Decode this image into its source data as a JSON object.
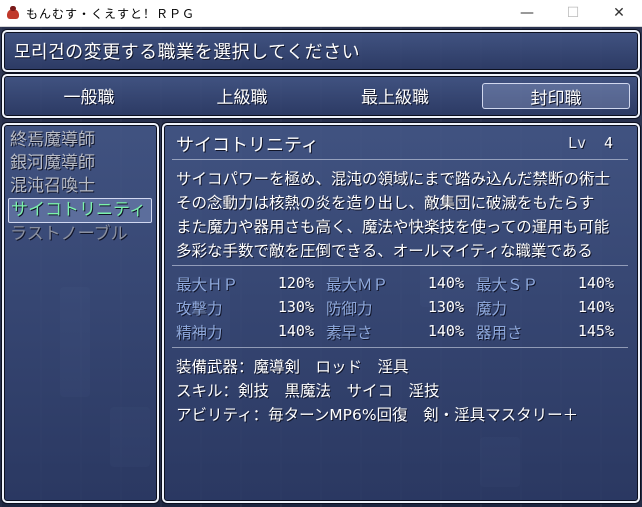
{
  "window": {
    "title": "もんむす・くえすと！ＲＰＧ",
    "controls": {
      "minimize": "—",
      "maximize": "☐",
      "close": "✕"
    }
  },
  "help": {
    "text": "모리건の変更する職業を選択してください"
  },
  "tabs": [
    {
      "label": "一般職",
      "selected": false
    },
    {
      "label": "上級職",
      "selected": false
    },
    {
      "label": "最上級職",
      "selected": false
    },
    {
      "label": "封印職",
      "selected": true
    }
  ],
  "job_list": [
    {
      "label": "終焉魔導師",
      "state": "dim"
    },
    {
      "label": "銀河魔導師",
      "state": "dim"
    },
    {
      "label": "混沌召喚士",
      "state": "dim"
    },
    {
      "label": "サイコトリニティ",
      "state": "selected"
    },
    {
      "label": "ラストノーブル",
      "state": "faded"
    }
  ],
  "detail": {
    "name": "サイコトリニティ",
    "lv_label": "Lv",
    "lv_value": "4",
    "description": [
      "サイコパワーを極め、混沌の領域にまで踏み込んだ禁断の術士",
      "その念動力は核熱の炎を造り出し、敵集団に破滅をもたらす",
      "また魔力や器用さも高く、魔法や快楽技を使っての運用も可能",
      "多彩な手数で敵を圧倒できる、オールマイティな職業である"
    ],
    "stats": [
      {
        "label": "最大ＨＰ",
        "value": "120%"
      },
      {
        "label": "最大ＭＰ",
        "value": "140%"
      },
      {
        "label": "最大ＳＰ",
        "value": "140%"
      },
      {
        "label": "攻撃力",
        "value": "130%"
      },
      {
        "label": "防御力",
        "value": "130%"
      },
      {
        "label": "魔力",
        "value": "140%"
      },
      {
        "label": "精神力",
        "value": "140%"
      },
      {
        "label": "素早さ",
        "value": "140%"
      },
      {
        "label": "器用さ",
        "value": "145%"
      }
    ],
    "equipment": "装備武器：魔導剣　ロッド　淫具",
    "skills": "スキル：剣技　黒魔法　サイコ　淫技",
    "abilities": "アビリティ：毎ターンMP6%回復　剣・淫具マスタリー＋"
  },
  "colors": {
    "window_border": "#eef2fa",
    "stat_label": "#8fa9dc",
    "selected_text": "#7cf2ac"
  }
}
